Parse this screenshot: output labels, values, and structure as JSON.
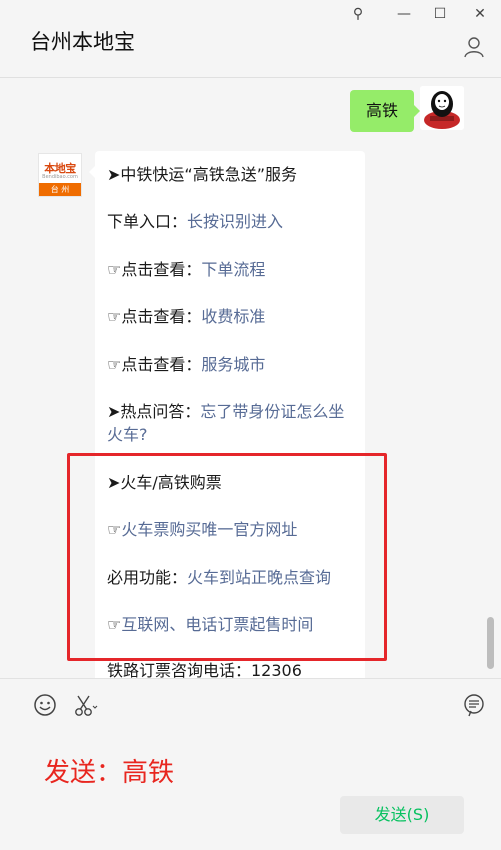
{
  "window": {
    "title": "台州本地宝",
    "controls": {
      "pin": "⚲",
      "minimize": "—",
      "maximize": "☐",
      "close": "✕"
    }
  },
  "sent_message": {
    "text": "高铁"
  },
  "bot": {
    "avatar": {
      "logo_top": "本地宝",
      "logo_mid": "Bendibao.com",
      "logo_bottom": "台 州"
    },
    "lines": [
      {
        "prefix": "➤中铁快运“高铁急送”服务",
        "link": ""
      },
      {
        "prefix": "下单入口：",
        "link": "长按识别进入"
      },
      {
        "prefix": "☞点击查看：",
        "link": "下单流程"
      },
      {
        "prefix": "☞点击查看：",
        "link": "收费标准"
      },
      {
        "prefix": "☞点击查看：",
        "link": "服务城市"
      },
      {
        "prefix": "➤热点问答：",
        "link": "忘了带身份证怎么坐火车?"
      },
      {
        "prefix": "➤火车/高铁购票",
        "link": ""
      },
      {
        "prefix": "☞",
        "link": "火车票购买唯一官方网址"
      },
      {
        "prefix": "必用功能：",
        "link": "火车到站正晚点查询"
      },
      {
        "prefix": "☞",
        "link": "互联网、电话订票起售时间"
      },
      {
        "prefix": "铁路订票咨询电话：12306",
        "link": ""
      }
    ]
  },
  "input": {
    "text": "发送：高铁"
  },
  "send_button": {
    "label": "发送(S)"
  },
  "colors": {
    "link": "#576b95",
    "my_bubble": "#95ec69",
    "highlight": "#e5262a",
    "send_text": "#07c160"
  }
}
